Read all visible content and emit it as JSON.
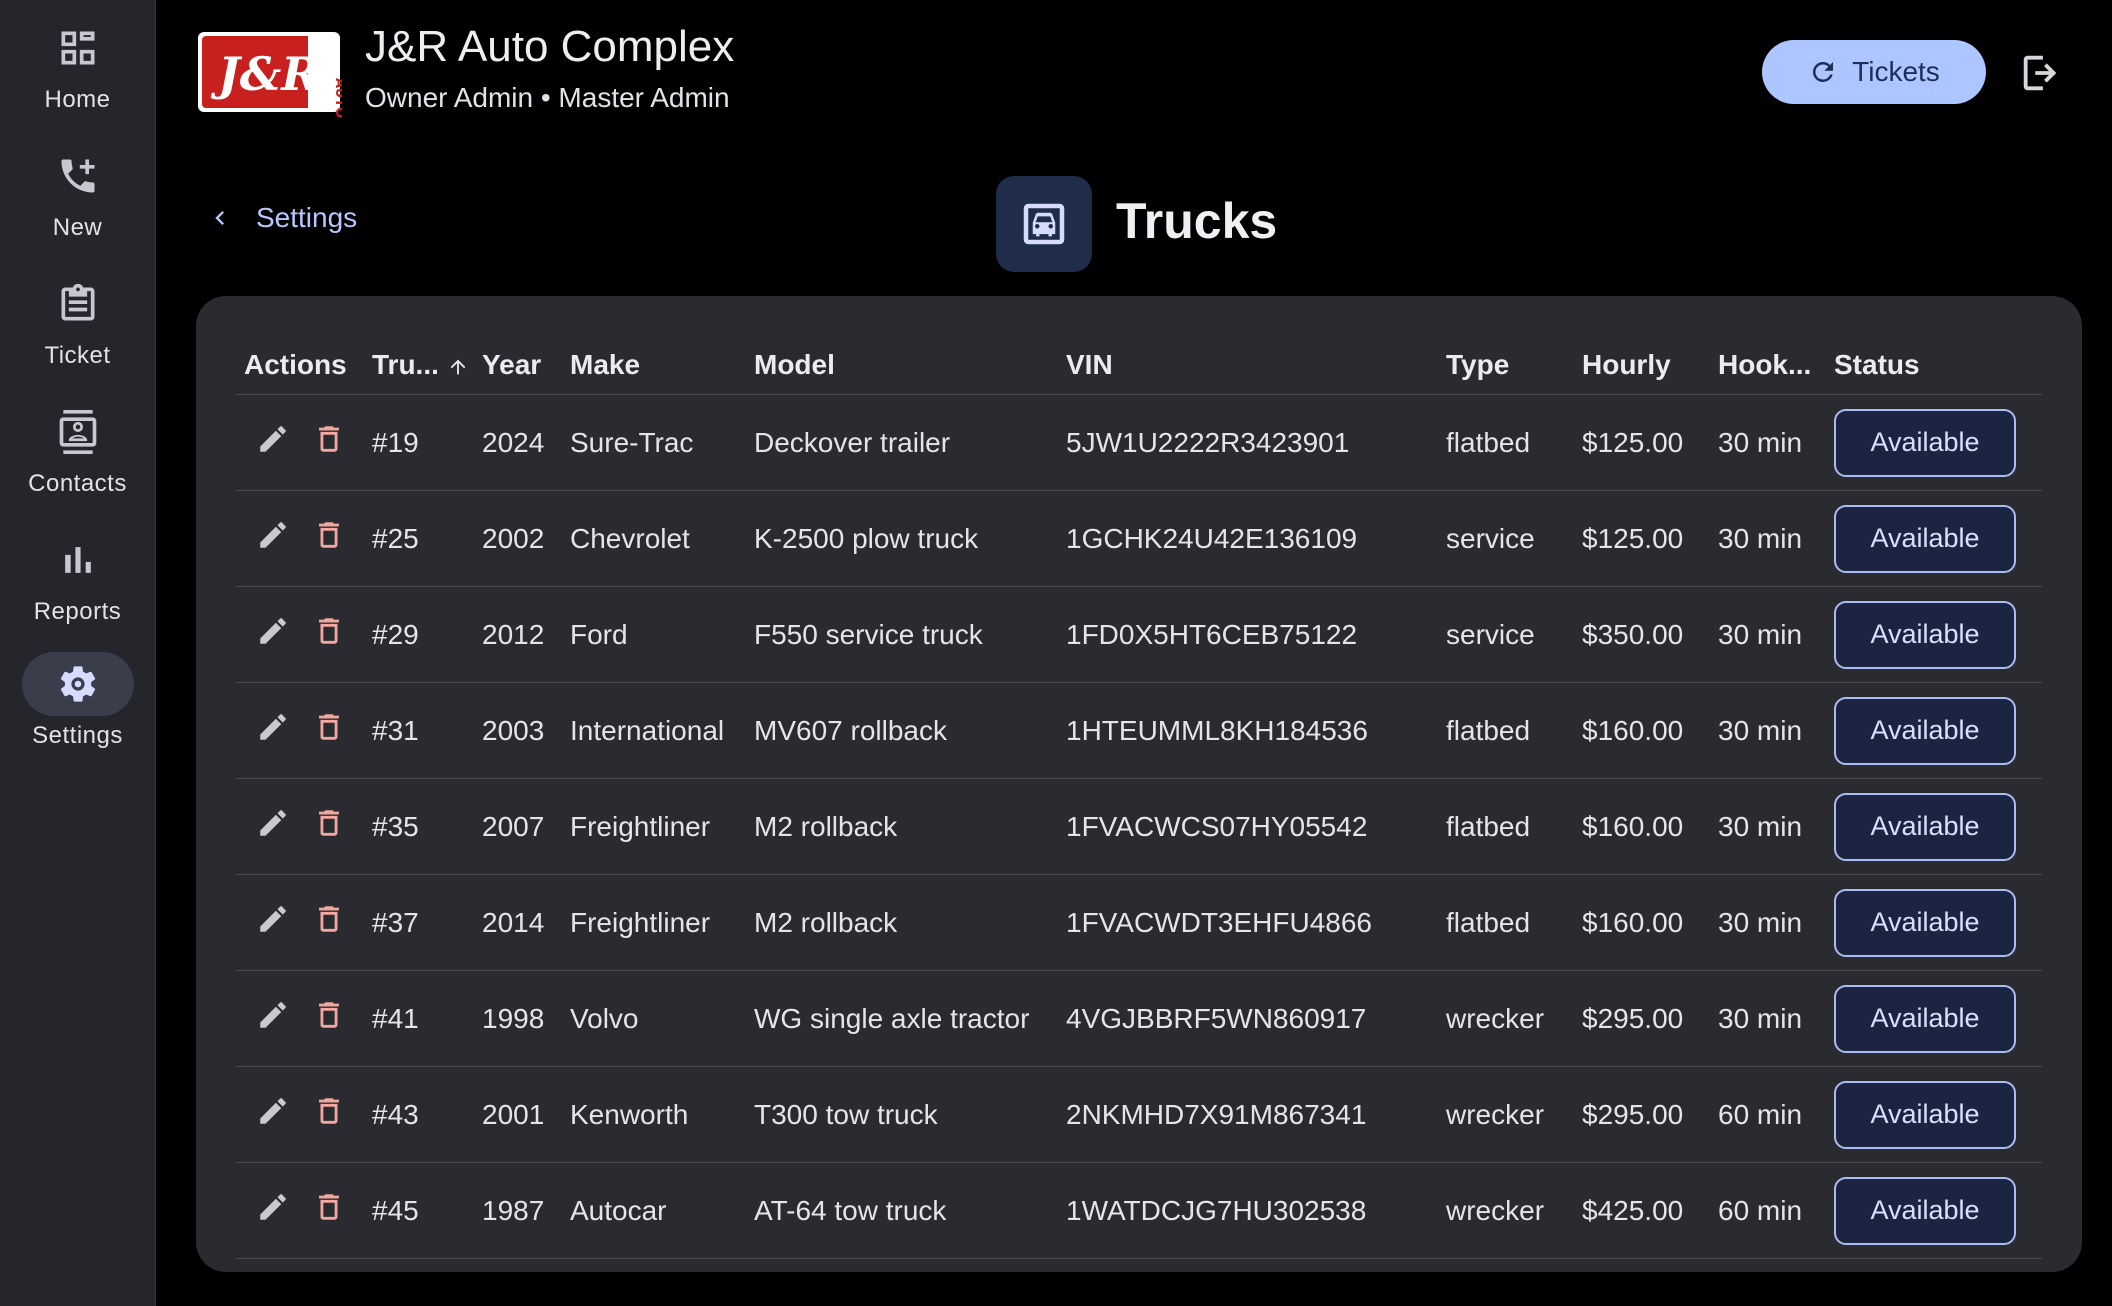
{
  "sidebar": {
    "items": [
      {
        "label": "Home",
        "icon": "dashboard-icon"
      },
      {
        "label": "New",
        "icon": "phone-add-icon"
      },
      {
        "label": "Ticket",
        "icon": "clipboard-icon"
      },
      {
        "label": "Contacts",
        "icon": "contact-card-icon"
      },
      {
        "label": "Reports",
        "icon": "bar-chart-icon"
      },
      {
        "label": "Settings",
        "icon": "gear-icon",
        "active": true
      }
    ]
  },
  "header": {
    "logo_text": "J&R AUTO",
    "title": "J&R Auto Complex",
    "subtitle": "Owner Admin • Master Admin",
    "tickets_label": "Tickets"
  },
  "subheader": {
    "back_label": "Settings",
    "page_title": "Trucks"
  },
  "table": {
    "columns": [
      "Actions",
      "Tru...",
      "Year",
      "Make",
      "Model",
      "VIN",
      "Type",
      "Hourly",
      "Hook...",
      "Status"
    ],
    "sorted_column": "Tru...",
    "rows": [
      {
        "truck": "#19",
        "year": "2024",
        "make": "Sure-Trac",
        "model": "Deckover trailer",
        "vin": "5JW1U2222R3423901",
        "type": "flatbed",
        "hourly": "$125.00",
        "hook": "30 min",
        "status": "Available"
      },
      {
        "truck": "#25",
        "year": "2002",
        "make": "Chevrolet",
        "model": "K-2500 plow truck",
        "vin": "1GCHK24U42E136109",
        "type": "service",
        "hourly": "$125.00",
        "hook": "30 min",
        "status": "Available"
      },
      {
        "truck": "#29",
        "year": "2012",
        "make": "Ford",
        "model": "F550 service truck",
        "vin": "1FD0X5HT6CEB75122",
        "type": "service",
        "hourly": "$350.00",
        "hook": "30 min",
        "status": "Available"
      },
      {
        "truck": "#31",
        "year": "2003",
        "make": "International",
        "model": "MV607 rollback",
        "vin": "1HTEUMML8KH184536",
        "type": "flatbed",
        "hourly": "$160.00",
        "hook": "30 min",
        "status": "Available"
      },
      {
        "truck": "#35",
        "year": "2007",
        "make": "Freightliner",
        "model": "M2 rollback",
        "vin": "1FVACWCS07HY05542",
        "type": "flatbed",
        "hourly": "$160.00",
        "hook": "30 min",
        "status": "Available"
      },
      {
        "truck": "#37",
        "year": "2014",
        "make": "Freightliner",
        "model": "M2 rollback",
        "vin": "1FVACWDT3EHFU4866",
        "type": "flatbed",
        "hourly": "$160.00",
        "hook": "30 min",
        "status": "Available"
      },
      {
        "truck": "#41",
        "year": "1998",
        "make": "Volvo",
        "model": "WG single axle tractor",
        "vin": "4VGJBBRF5WN860917",
        "type": "wrecker",
        "hourly": "$295.00",
        "hook": "30 min",
        "status": "Available"
      },
      {
        "truck": "#43",
        "year": "2001",
        "make": "Kenworth",
        "model": "T300 tow truck",
        "vin": "2NKMHD7X91M867341",
        "type": "wrecker",
        "hourly": "$295.00",
        "hook": "60 min",
        "status": "Available"
      },
      {
        "truck": "#45",
        "year": "1987",
        "make": "Autocar",
        "model": "AT-64 tow truck",
        "vin": "1WATDCJG7HU302538",
        "type": "wrecker",
        "hourly": "$425.00",
        "hook": "60 min",
        "status": "Available"
      }
    ]
  },
  "colors": {
    "accent": "#aec6ff",
    "delete": "#f2a7a0",
    "card": "#2a2b31",
    "sidebar": "#25262c"
  }
}
